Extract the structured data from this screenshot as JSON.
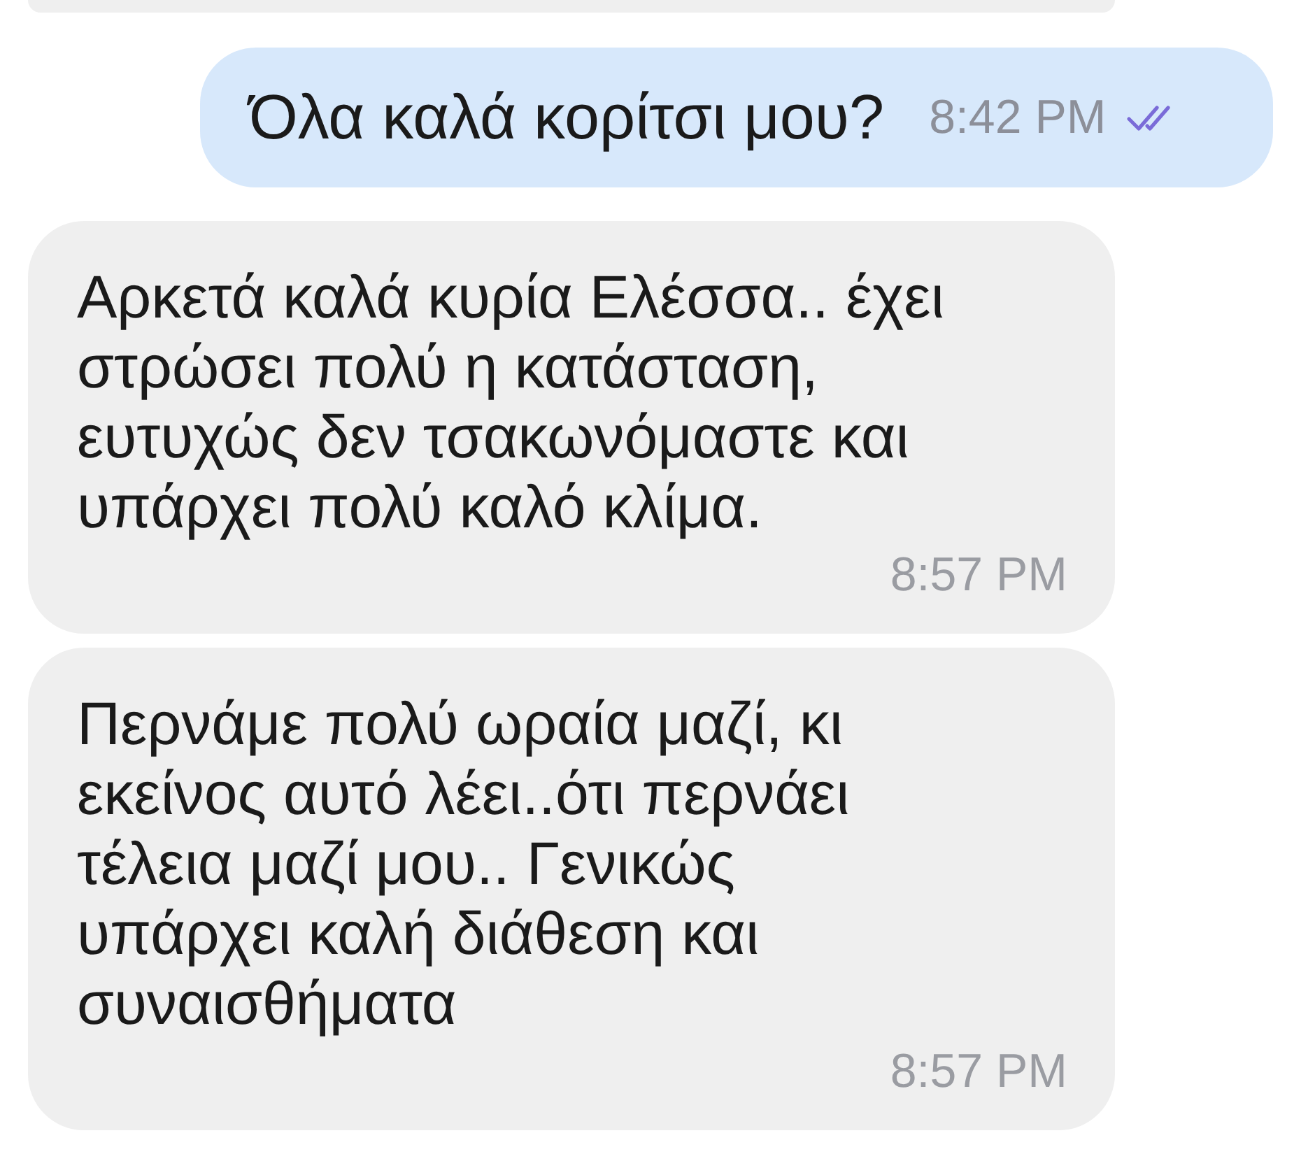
{
  "messages": [
    {
      "kind": "outgoing",
      "text": "Όλα καλά κορίτσι μου?",
      "time": "8:42 PM",
      "read": true
    },
    {
      "kind": "incoming",
      "text": "Αρκετά καλά κυρία Ελέσσα.. έχει\nστρώσει πολύ η κατάσταση,\nευτυχώς δεν τσακωνόμαστε και\nυπάρχει πολύ καλό κλίμα.",
      "time": "8:57 PM"
    },
    {
      "kind": "incoming",
      "text": "Περνάμε πολύ ωραία μαζί, κι\nεκείνος αυτό λέει..ότι περνάει\nτέλεια μαζί μου.. Γενικώς\nυπάρχει καλή διάθεση και\nσυναισθήματα",
      "time": "8:57 PM"
    }
  ]
}
